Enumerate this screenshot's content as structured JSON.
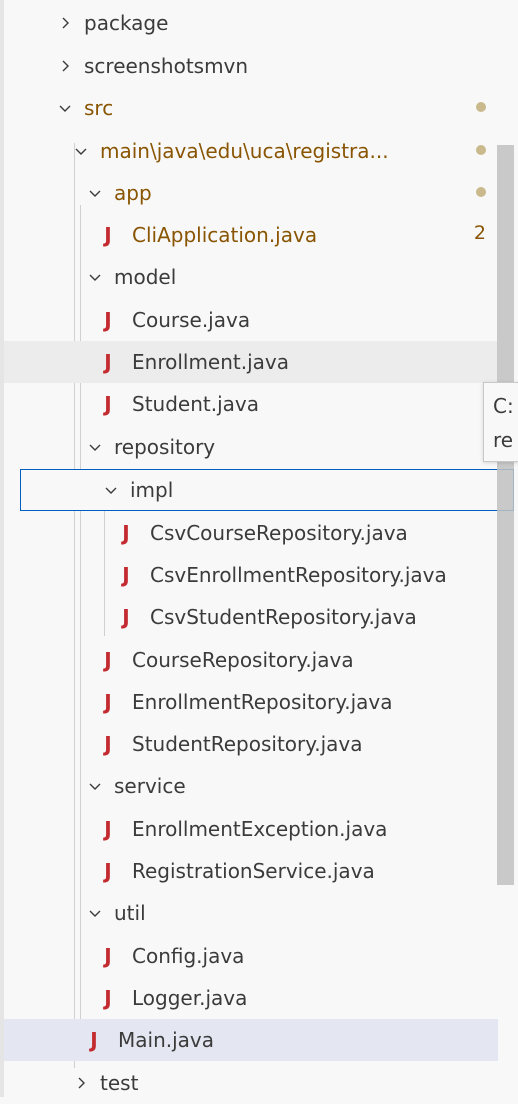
{
  "tree": {
    "package": {
      "label": "package"
    },
    "screenshotsmvn": {
      "label": "screenshotsmvn"
    },
    "src": {
      "label": "src"
    },
    "main_path": {
      "label": "main\\java\\edu\\uca\\registra..."
    },
    "app": {
      "label": "app"
    },
    "cli_application": {
      "label": "CliApplication.java",
      "badge": "2"
    },
    "model": {
      "label": "model"
    },
    "course": {
      "label": "Course.java"
    },
    "enrollment": {
      "label": "Enrollment.java"
    },
    "student": {
      "label": "Student.java"
    },
    "repository": {
      "label": "repository"
    },
    "impl": {
      "label": "impl"
    },
    "csv_course_repository": {
      "label": "CsvCourseRepository.java"
    },
    "csv_enrollment_repository": {
      "label": "CsvEnrollmentRepository.java"
    },
    "csv_student_repository": {
      "label": "CsvStudentRepository.java"
    },
    "course_repository": {
      "label": "CourseRepository.java"
    },
    "enrollment_repository": {
      "label": "EnrollmentRepository.java"
    },
    "student_repository": {
      "label": "StudentRepository.java"
    },
    "service": {
      "label": "service"
    },
    "enrollment_exception": {
      "label": "EnrollmentException.java"
    },
    "registration_service": {
      "label": "RegistrationService.java"
    },
    "util": {
      "label": "util"
    },
    "config": {
      "label": "Config.java"
    },
    "logger": {
      "label": "Logger.java"
    },
    "main_java": {
      "label": "Main.java"
    },
    "test": {
      "label": "test"
    }
  },
  "tooltip": {
    "line1": "C:",
    "line2": "re"
  },
  "icons": {
    "java_file": "java-file-icon",
    "chevron_right": "chevron-right-icon",
    "chevron_down": "chevron-down-icon",
    "modified_dot": "modified-dot-icon"
  },
  "colors": {
    "java_icon": "#c32b30",
    "modified_text": "#895503",
    "focus_border": "#0060c0",
    "selected_bg": "#e4e6f1",
    "hover_bg": "#ececec",
    "background": "#f8f8f8"
  }
}
